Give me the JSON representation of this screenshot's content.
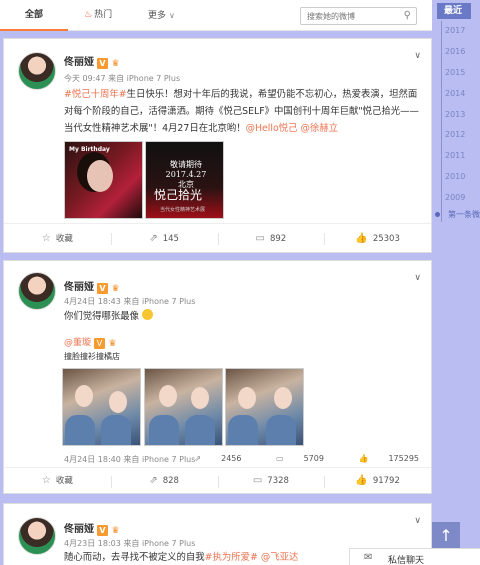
{
  "tabs": {
    "all": "全部",
    "hot": "热门",
    "more": "更多"
  },
  "search": {
    "placeholder": "搜索她的微博"
  },
  "years": {
    "head": "最近",
    "list": [
      "2017",
      "2016",
      "2015",
      "2014",
      "2013",
      "2012",
      "2011",
      "2010",
      "2009"
    ],
    "first": "第一条微"
  },
  "posts": [
    {
      "user": "佟丽娅",
      "level": "3",
      "meta": "今天 09:47 来自 iPhone 7 Plus",
      "text_parts": {
        "tag": "#悦己十周年#",
        "body": "生日快乐！想对十年后的我说，希望仍能不忘初心，热爱表演，坦然面对每个阶段的自己，活得潇洒。期待《悦己SELF》中国创刊十周年巨献\"悦己拾光——当代女性精神艺术展\"！4月27日在北京哟！",
        "mention1": "@Hello悦己",
        "mention2": "@徐赫立"
      },
      "photo1": {
        "title": "My Birthday",
        "alt": "portrait"
      },
      "photo2": {
        "date": "敬请期待\n2017.4.27\n北京",
        "title": "悦己拾光",
        "sub": "当代女性精神艺术展"
      },
      "actions": {
        "fav": "收藏",
        "forward": "145",
        "comment": "892",
        "like": "25303"
      }
    },
    {
      "user": "佟丽娅",
      "level": "3",
      "meta": "4月24日 18:43 来自 iPhone 7 Plus",
      "text": "你们觉得哪张最像",
      "quote": {
        "name": "@董璇",
        "level": "3",
        "text": "撞脸撞衫撞橘店",
        "meta": "4月24日 18:40 来自 iPhone 7 Plus",
        "forward": "2456",
        "comment": "5709",
        "like": "175295"
      },
      "actions": {
        "fav": "收藏",
        "forward": "828",
        "comment": "7328",
        "like": "91792"
      }
    },
    {
      "user": "佟丽娅",
      "level": "3",
      "meta": "4月23日 18:03 来自 iPhone 7 Plus",
      "text_parts": {
        "body": "随心而动，去寻找不被定义的自我",
        "tag": "#执为所爱#",
        "mention": "@飞亚达"
      }
    }
  ],
  "footer": {
    "message": "私信聊天"
  }
}
